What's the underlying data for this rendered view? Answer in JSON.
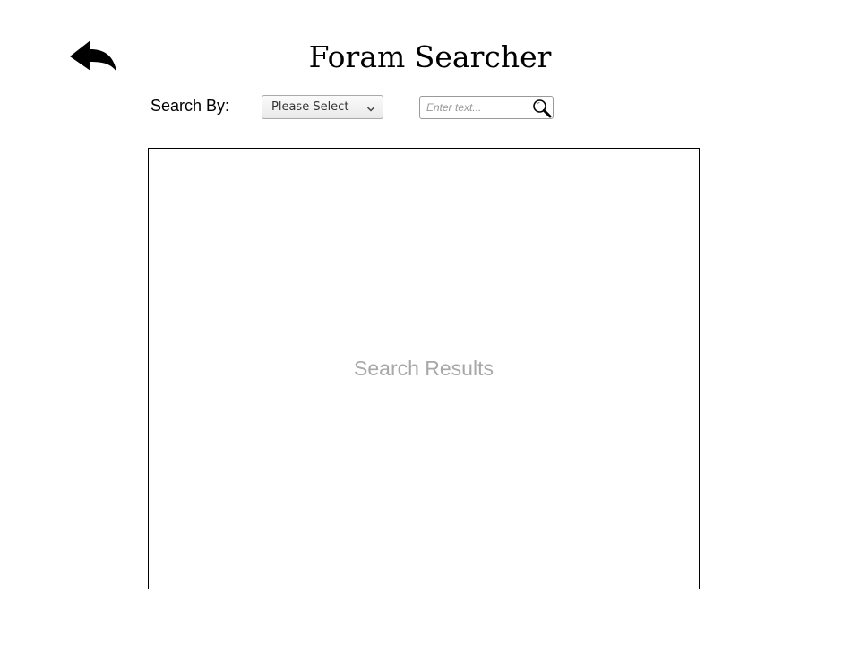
{
  "header": {
    "title": "Foram Searcher",
    "back_icon": "reply-arrow-icon"
  },
  "search": {
    "label": "Search By:",
    "select_value": "Please Select",
    "select_icon": "chevron-down-icon",
    "input_value": "",
    "input_placeholder": "Enter text...",
    "search_icon": "magnifier-icon"
  },
  "results": {
    "placeholder": "Search Results"
  },
  "colors": {
    "border": "#000000",
    "placeholder_text": "#a8a8a8"
  }
}
